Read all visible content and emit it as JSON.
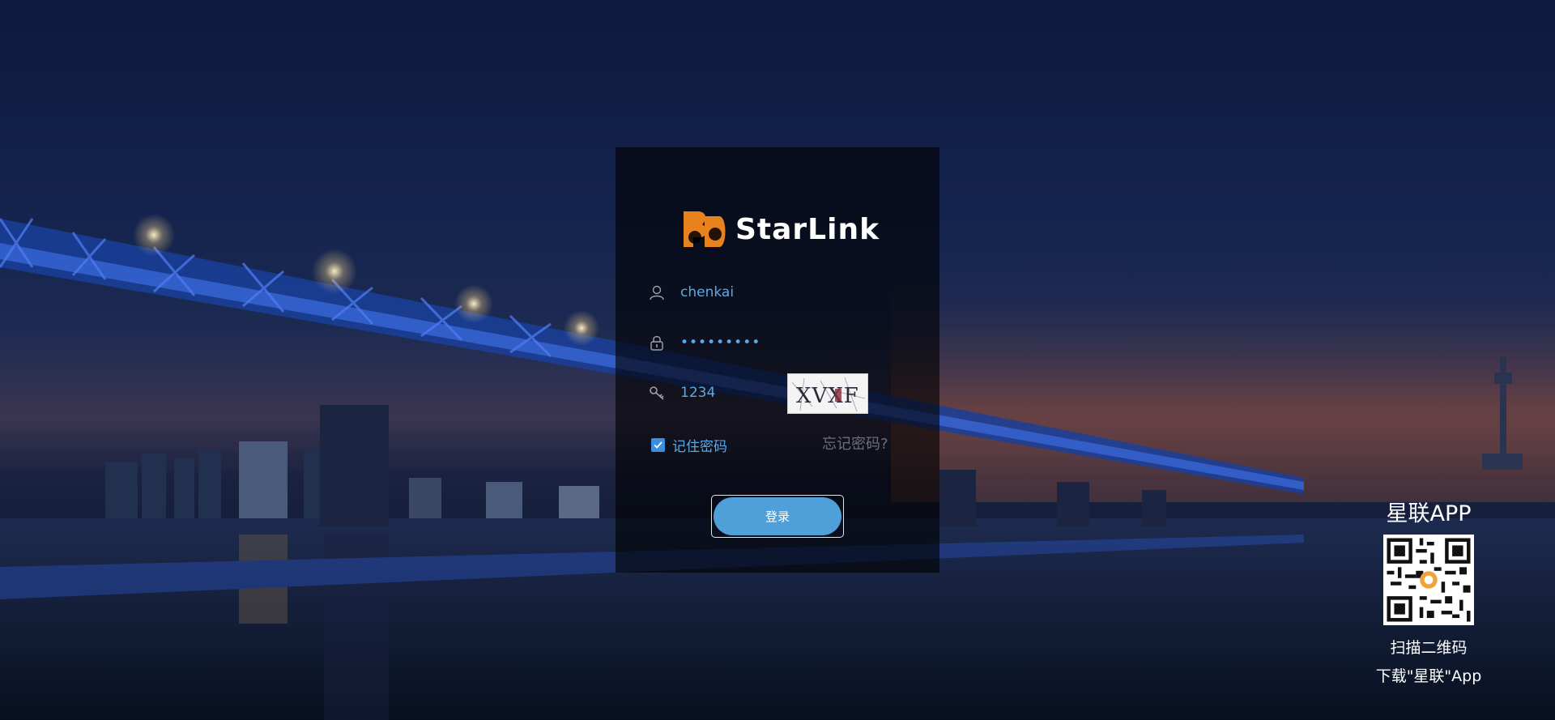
{
  "brand": {
    "logo_text": "StarLink",
    "accent": "#e8821e"
  },
  "login": {
    "username": "chenkai",
    "password": "•••••••••",
    "captcha_input": "1234",
    "captcha_text": "XVXF",
    "remember_label": "记住密码",
    "remember_checked": true,
    "forgot_label": "忘记密码?",
    "login_button": "登录",
    "input_color": "#5aa9e6",
    "button_color": "#4f9fd8"
  },
  "app_promo": {
    "title": "星联APP",
    "scan_text": "扫描二维码",
    "download_text": "下载\"星联\"App"
  },
  "icons": {
    "user": "user-icon",
    "lock": "lock-icon",
    "key": "key-icon",
    "check": "check-icon",
    "qr": "qr-code"
  }
}
